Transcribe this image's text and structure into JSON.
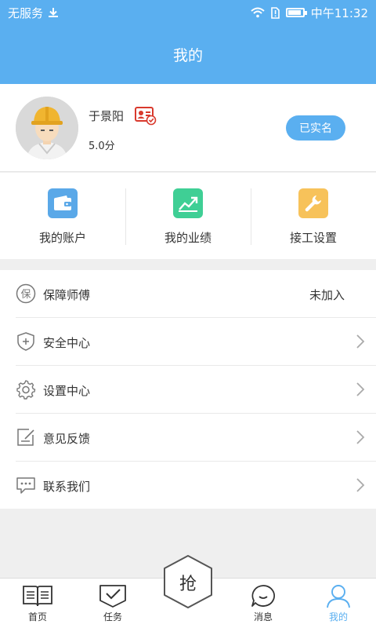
{
  "status_bar": {
    "carrier": "无服务",
    "time": "中午11:32",
    "icons": [
      "download-icon",
      "wifi-icon",
      "sim-alert-icon",
      "battery-icon"
    ]
  },
  "header": {
    "title": "我的"
  },
  "profile": {
    "name": "于景阳",
    "rating": "5.0分",
    "verified_label": "已实名"
  },
  "quick_actions": [
    {
      "label": "我的账户",
      "icon": "wallet-icon",
      "color": "#5aa8e8"
    },
    {
      "label": "我的业绩",
      "icon": "trend-chart-icon",
      "color": "#3fcf95"
    },
    {
      "label": "接工设置",
      "icon": "wrench-icon",
      "color": "#f7c25a"
    }
  ],
  "menu": [
    {
      "label": "保障师傅",
      "icon": "guarantee-icon",
      "value": "未加入"
    },
    {
      "label": "安全中心",
      "icon": "shield-icon"
    },
    {
      "label": "设置中心",
      "icon": "gear-icon"
    },
    {
      "label": "意见反馈",
      "icon": "feedback-icon"
    },
    {
      "label": "联系我们",
      "icon": "chat-dots-icon"
    }
  ],
  "tabbar": {
    "items": [
      {
        "label": "首页",
        "icon": "book-icon"
      },
      {
        "label": "任务",
        "icon": "task-check-icon"
      },
      {
        "label": "消息",
        "icon": "message-icon"
      },
      {
        "label": "我的",
        "icon": "user-icon",
        "active": true
      }
    ],
    "center_label": "抢"
  },
  "colors": {
    "accent": "#5aaff0",
    "background": "#efefef"
  }
}
